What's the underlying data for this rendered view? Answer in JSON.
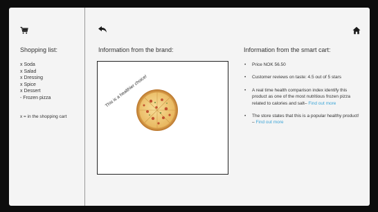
{
  "sidebar": {
    "icon": "shopping-cart-icon",
    "title": "Shopping list:",
    "items": [
      "x Soda",
      "x Salad",
      "x Dressing",
      "x Spice",
      "x Dessert",
      "- Frozen pizza"
    ],
    "legend": "x = in the shopping cart"
  },
  "nav": {
    "back_icon": "back-arrow-icon",
    "home_icon": "home-icon"
  },
  "brand": {
    "title": "Information from the brand:",
    "claim": "This is a healthier choice!",
    "image": "pizza-image"
  },
  "cart": {
    "title": "Information from the smart cart:",
    "price": "Price NOK 56.50",
    "reviews": "Customer reviews on taste: 4.5 out of 5 stars",
    "health_text": "A real time health comparison index identify this product as one of the most nutritious frozen pizza related to calories and salt–",
    "health_link": "Find out more",
    "popular_text": "The store states that this is a popular healthy product! –",
    "popular_link": "Find out more",
    "bullet": "•"
  },
  "colors": {
    "background": "#f4f4f4",
    "link": "#3ba4d6",
    "text": "#333333"
  }
}
